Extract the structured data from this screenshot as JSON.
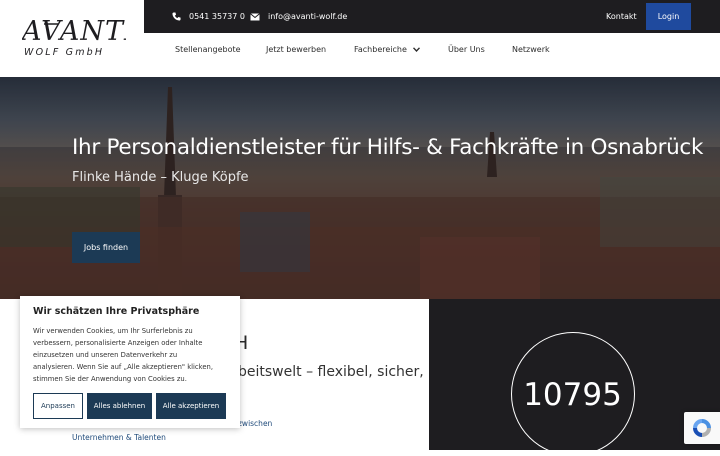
{
  "brand": {
    "logo_line1": "AVANTI",
    "logo_line2": "WOLF GmbH"
  },
  "topbar": {
    "phone": "0541 35737 0",
    "email": "info@avanti-wolf.de",
    "kontakt": "Kontakt",
    "login": "Login"
  },
  "nav": {
    "items": [
      {
        "label": "Stellenangebote"
      },
      {
        "label": "Jetzt bewerben"
      },
      {
        "label": "Fachbereiche"
      },
      {
        "label": "Über Uns"
      },
      {
        "label": "Netzwerk"
      }
    ]
  },
  "hero": {
    "title": "Ihr Personaldienstleister für Hilfs- & Fachkräfte in Osnabrück",
    "subtitle": "Flinke Hände – Kluge Köpfe",
    "cta": "Jobs finden"
  },
  "about": {
    "title_partial": "bH",
    "text_partial": "beitswelt – flexibel, sicher,",
    "link1_partial": "zwischen",
    "link2": "Unternehmen & Talenten"
  },
  "counter": {
    "value": "10795"
  },
  "cookie": {
    "title": "Wir schätzen Ihre Privatsphäre",
    "lines": [
      "Wir verwenden Cookies, um Ihr Surferlebnis zu",
      "verbessern, personalisierte Anzeigen oder Inhalte",
      "einzusetzen und unseren Datenverkehr zu",
      "analysieren. Wenn Sie auf „Alle akzeptieren\" klicken,",
      "stimmen Sie der Anwendung von Cookies zu."
    ],
    "btn_adjust": "Anpassen",
    "btn_reject": "Alles ablehnen",
    "btn_accept": "Alle akzeptieren"
  },
  "colors": {
    "dark": "#1e1d20",
    "login_blue": "#1f4a9e",
    "navy": "#1c3a55"
  }
}
